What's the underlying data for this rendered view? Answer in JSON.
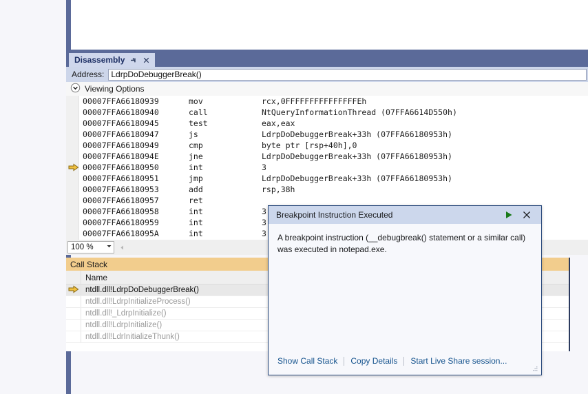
{
  "disassembly": {
    "tab_label": "Disassembly",
    "pin_icon": "pin-icon",
    "close_icon": "close-icon",
    "address_label": "Address:",
    "address_value": "LdrpDoDebuggerBreak()",
    "address_placeholder": "Address",
    "viewing_options_label": "Viewing Options",
    "viewing_options_icon": "chevron-down-circle-icon",
    "zoom_level": "100 %",
    "zoom_dropdown_icon": "chevron-down-icon",
    "scroll_left_icon": "triangle-left-icon",
    "current_ip_icon": "yellow-arrow-icon",
    "lines": [
      {
        "address": "00007FFA66180939",
        "mnemonic": "mov",
        "operands": "rcx,0FFFFFFFFFFFFFFFEh",
        "current": false
      },
      {
        "address": "00007FFA66180940",
        "mnemonic": "call",
        "operands": "NtQueryInformationThread (07FFA6614D550h)",
        "current": false
      },
      {
        "address": "00007FFA66180945",
        "mnemonic": "test",
        "operands": "eax,eax",
        "current": false
      },
      {
        "address": "00007FFA66180947",
        "mnemonic": "js",
        "operands": "LdrpDoDebuggerBreak+33h (07FFA66180953h)",
        "current": false
      },
      {
        "address": "00007FFA66180949",
        "mnemonic": "cmp",
        "operands": "byte ptr [rsp+40h],0",
        "current": false
      },
      {
        "address": "00007FFA6618094E",
        "mnemonic": "jne",
        "operands": "LdrpDoDebuggerBreak+33h (07FFA66180953h)",
        "current": false
      },
      {
        "address": "00007FFA66180950",
        "mnemonic": "int",
        "operands": "3",
        "current": true
      },
      {
        "address": "00007FFA66180951",
        "mnemonic": "jmp",
        "operands": "LdrpDoDebuggerBreak+33h (07FFA66180953h)",
        "current": false
      },
      {
        "address": "00007FFA66180953",
        "mnemonic": "add",
        "operands": "rsp,38h",
        "current": false
      },
      {
        "address": "00007FFA66180957",
        "mnemonic": "ret",
        "operands": "",
        "current": false
      },
      {
        "address": "00007FFA66180958",
        "mnemonic": "int",
        "operands": "3",
        "current": false
      },
      {
        "address": "00007FFA66180959",
        "mnemonic": "int",
        "operands": "3",
        "current": false
      },
      {
        "address": "00007FFA6618095A",
        "mnemonic": "int",
        "operands": "3",
        "current": false
      }
    ]
  },
  "call_stack": {
    "title": "Call Stack",
    "column_name": "Name",
    "current_frame_icon": "yellow-arrow-icon",
    "frames": [
      {
        "name": "ntdll.dll!LdrpDoDebuggerBreak()",
        "current": true
      },
      {
        "name": "ntdll.dll!LdrpInitializeProcess()",
        "current": false
      },
      {
        "name": "ntdll.dll!_LdrpInitialize()",
        "current": false
      },
      {
        "name": "ntdll.dll!LdrpInitialize()",
        "current": false
      },
      {
        "name": "ntdll.dll!LdrInitializeThunk()",
        "current": false
      }
    ]
  },
  "breakpoint_dialog": {
    "title": "Breakpoint Instruction Executed",
    "continue_icon": "play-continue-icon",
    "close_icon": "close-icon",
    "message": "A breakpoint instruction (__debugbreak() statement or a similar call) was executed in notepad.exe.",
    "links": [
      "Show Call Stack",
      "Copy Details",
      "Start Live Share session..."
    ],
    "resize_grip_icon": "resize-grip-icon"
  },
  "colors": {
    "shell_band": "#5b6a99",
    "tab_active": "#cfd7ec",
    "callstack_header": "#f2cd8d",
    "dialog_border": "#2a4a7c",
    "dialog_title_bg": "#ccd7ec",
    "link": "#16548e",
    "continue_green": "#1a7a1a",
    "ip_arrow": "#f0c040"
  }
}
